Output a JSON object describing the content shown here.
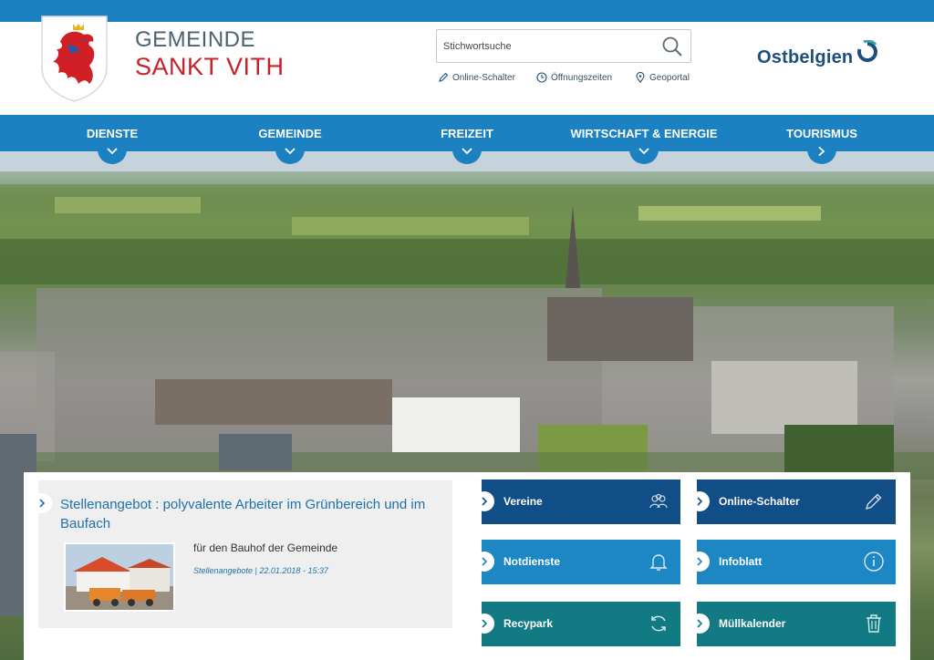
{
  "header": {
    "municipality_line1": "GEMEINDE",
    "municipality_line2": "SANKT VITH",
    "brand": "Ostbelgien"
  },
  "search": {
    "placeholder": "Stichwortsuche"
  },
  "quicklinks": [
    {
      "label": "Online-Schalter",
      "icon": "pencil-icon"
    },
    {
      "label": "Öffnungszeiten",
      "icon": "clock-icon"
    },
    {
      "label": "Geoportal",
      "icon": "map-pin-icon"
    }
  ],
  "nav": [
    {
      "label": "DIENSTE",
      "indicator": "chevron-down"
    },
    {
      "label": "GEMEINDE",
      "indicator": "chevron-down"
    },
    {
      "label": "FREIZEIT",
      "indicator": "chevron-down"
    },
    {
      "label": "WIRTSCHAFT & ENERGIE",
      "indicator": "chevron-down"
    },
    {
      "label": "TOURISMUS",
      "indicator": "chevron-right"
    }
  ],
  "news": {
    "title": "Stellenangebot : polyvalente Arbeiter im Grünbereich und im Baufach",
    "description": "für den Bauhof der Gemeinde",
    "meta": "Stellenangebote | 22.01.2018 - 15:37"
  },
  "tiles": [
    {
      "label": "Vereine",
      "icon": "people-icon",
      "color": "#124e86"
    },
    {
      "label": "Online-Schalter",
      "icon": "pencil-icon",
      "color": "#124e86"
    },
    {
      "label": "Notdienste",
      "icon": "bell-icon",
      "color": "#1d87c4"
    },
    {
      "label": "Infoblatt",
      "icon": "info-icon",
      "color": "#1d87c4"
    },
    {
      "label": "Recypark",
      "icon": "recycle-icon",
      "color": "#117a82"
    },
    {
      "label": "Müllkalender",
      "icon": "trash-icon",
      "color": "#117a82"
    }
  ],
  "colors": {
    "primary_blue": "#1c81c0",
    "brand_red": "#c8212a",
    "navy": "#124e86",
    "teal": "#117a82"
  }
}
